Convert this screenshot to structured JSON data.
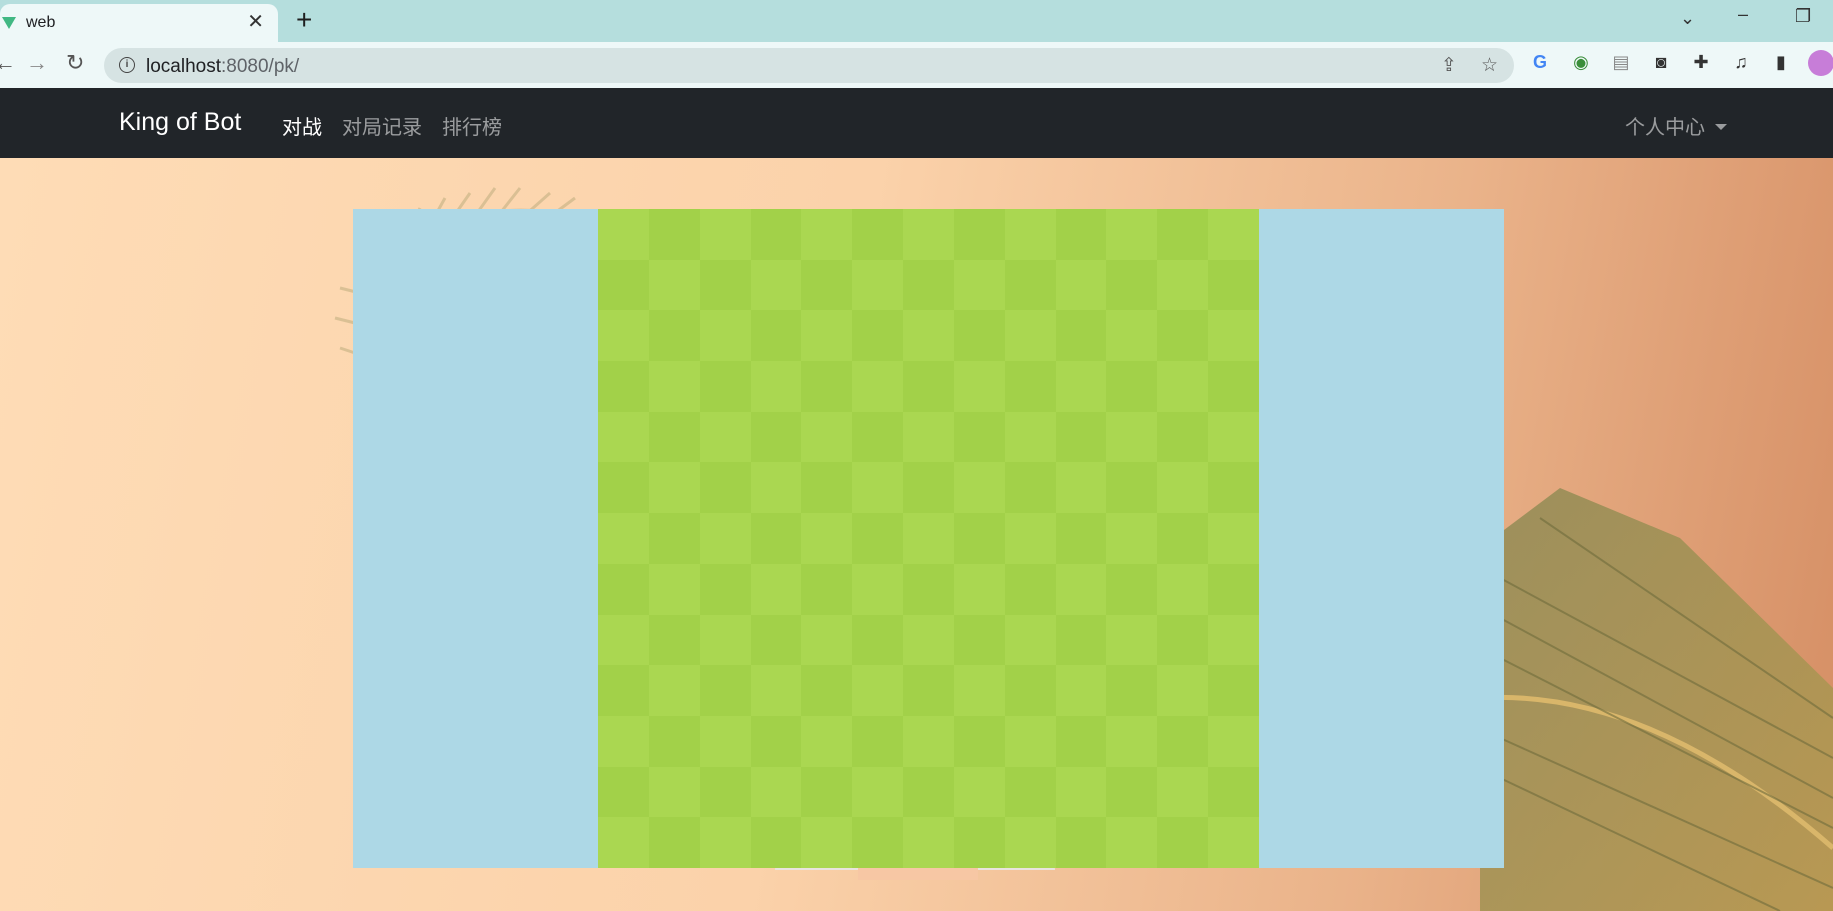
{
  "browser": {
    "tab_title": "web",
    "tab_close": "✕",
    "new_tab": "+",
    "url_host": "localhost",
    "url_rest": ":8080/pk/",
    "icons": [
      "back-arrow-icon",
      "forward-arrow-icon",
      "reload-icon",
      "info-icon",
      "share-icon",
      "star-icon",
      "translate-icon",
      "extension-icon",
      "puzzle-icon",
      "media-icon",
      "sidebar-icon",
      "profile-avatar"
    ]
  },
  "navbar": {
    "brand": "King of Bot",
    "links": [
      {
        "label": "对战",
        "active": true
      },
      {
        "label": "对局记录",
        "active": false
      },
      {
        "label": "排行榜",
        "active": false
      }
    ],
    "dropdown": "个人中心"
  },
  "game": {
    "rows": 13,
    "cols": 13,
    "colors": {
      "light": "#aad751",
      "dark": "#a2d149",
      "background": "#add8e6"
    }
  },
  "colors": {
    "navbar": "#212529",
    "chrome_tabstrip": "#b5dedd"
  }
}
